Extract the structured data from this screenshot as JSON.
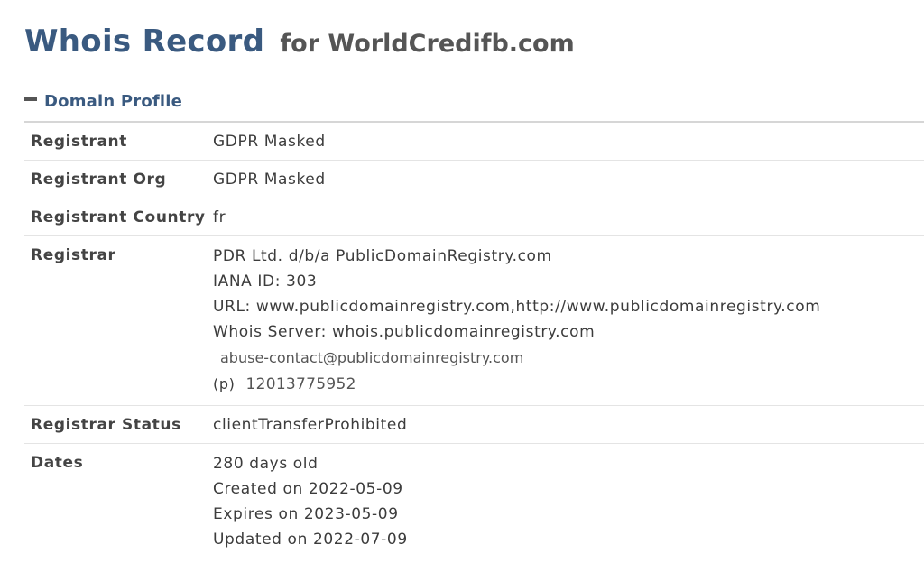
{
  "page": {
    "title_main": "Whois Record",
    "title_sub": "for WorldCredifb.com"
  },
  "section": {
    "label": "Domain Profile",
    "icon": "minus-icon"
  },
  "rows": {
    "registrant": {
      "key": "Registrant",
      "value": "GDPR Masked"
    },
    "registrant_org": {
      "key": "Registrant Org",
      "value": "GDPR Masked"
    },
    "registrant_country": {
      "key": "Registrant Country",
      "value": "fr"
    },
    "registrar": {
      "key": "Registrar",
      "name": "PDR Ltd. d/b/a PublicDomainRegistry.com",
      "iana": "IANA ID: 303",
      "url": "URL: www.publicdomainregistry.com,http://www.publicdomainregistry.com",
      "whois_server": "Whois Server: whois.publicdomainregistry.com",
      "abuse_email": "abuse-contact@publicdomainregistry.com",
      "phone_prefix": "(p)",
      "phone": "12013775952"
    },
    "registrar_status": {
      "key": "Registrar Status",
      "value": "clientTransferProhibited"
    },
    "dates": {
      "key": "Dates",
      "age": "280 days old",
      "created": "Created on 2022-05-09",
      "expires": "Expires on 2023-05-09",
      "updated": "Updated on 2022-07-09"
    }
  },
  "colors": {
    "title_accent": "#3a5a80",
    "text": "#3c3c3c",
    "divider": "#d6d6d6"
  }
}
